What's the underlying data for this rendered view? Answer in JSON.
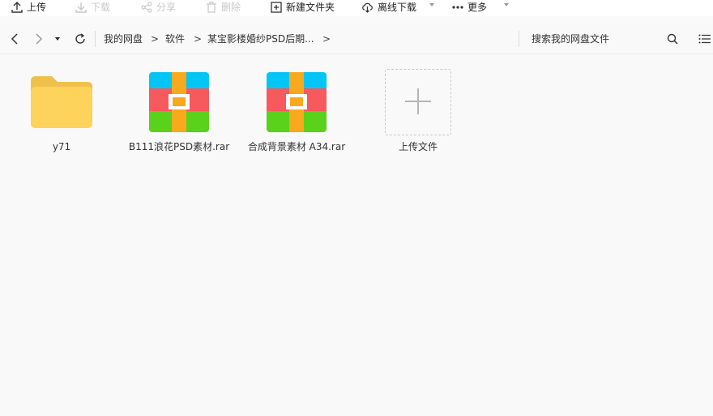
{
  "toolbar": {
    "upload": "上传",
    "download": "下载",
    "share": "分享",
    "delete": "删除",
    "new_folder": "新建文件夹",
    "offline_download": "离线下载",
    "more": "更多"
  },
  "nav": {
    "breadcrumb": [
      "我的网盘",
      "软件",
      "某宝影楼婚纱PSD后期..."
    ],
    "separator": ">",
    "search_placeholder": "搜索我的网盘文件"
  },
  "files": [
    {
      "name": "y71",
      "type": "folder"
    },
    {
      "name": "B111浪花PSD素材.rar",
      "type": "rar"
    },
    {
      "name": "合成背景素材 A34.rar",
      "type": "rar"
    }
  ],
  "upload_tile": {
    "label": "上传文件"
  },
  "colors": {
    "folder": "#fdd35c",
    "folder_tab": "#efc14b",
    "rar_cyan": "#00c5f5",
    "rar_red": "#f65a5c",
    "rar_green": "#5ad11a",
    "rar_strap": "#f8a91d"
  }
}
